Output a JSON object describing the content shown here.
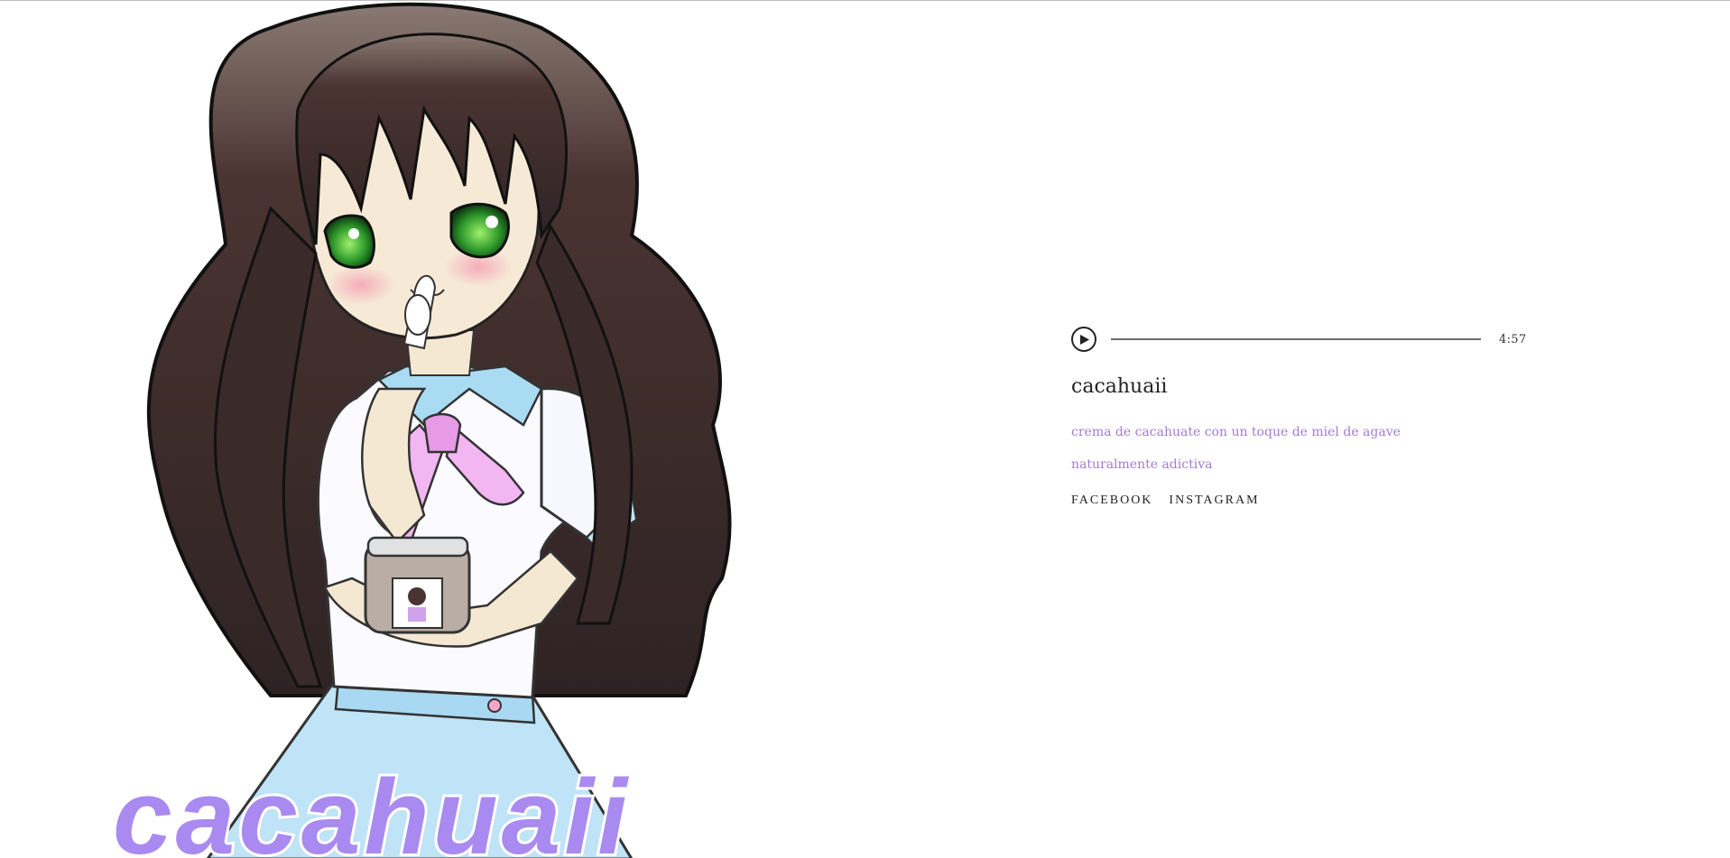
{
  "artwork": {
    "alt_icon": "anime-girl-with-jar-illustration",
    "logo_text": "cacahuaii",
    "logo_color": "#a98af0"
  },
  "player": {
    "play_icon": "play-icon",
    "duration": "4:57",
    "progress": 0
  },
  "track": {
    "title": "cacahuaii",
    "description_lines": [
      "crema de cacahuate con un toque de miel de agave",
      "naturalmente adictiva"
    ],
    "accent_color": "#a27cd3"
  },
  "links": [
    {
      "label": "FACEBOOK"
    },
    {
      "label": "INSTAGRAM"
    }
  ]
}
